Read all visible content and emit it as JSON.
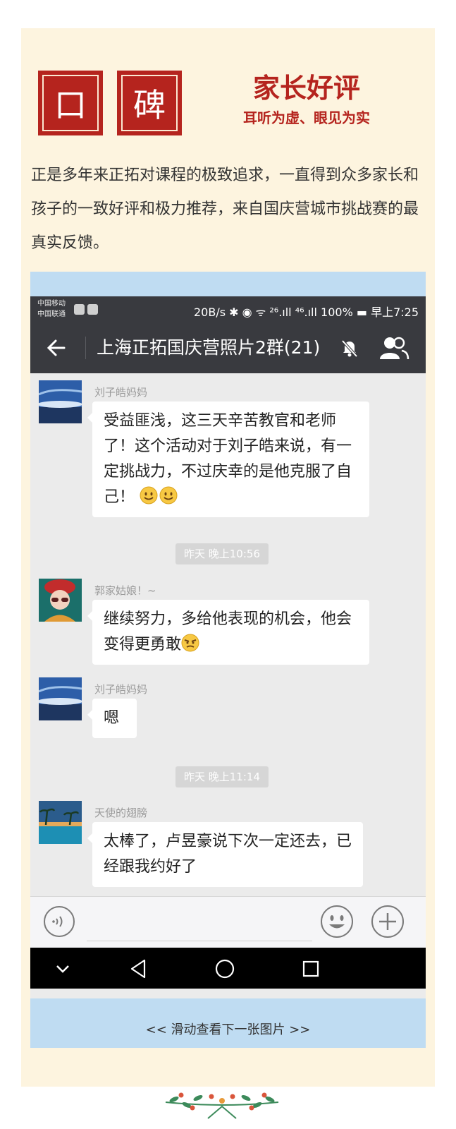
{
  "header": {
    "seal_1": "口",
    "seal_2": "碑",
    "title": "家长好评",
    "subtitle": "耳听为虚、眼见为实"
  },
  "intro_text": "正是多年来正拓对课程的极致追求，一直得到众多家长和孩子的一致好评和极力推荐，来自国庆营城市挑战赛的最真实反馈。",
  "status_bar": {
    "carrier_1": "中国移动",
    "carrier_2": "中国联通",
    "right": "20B/s ✱ ◉ ᯤ ²⁶.ıll ⁴⁶.ıll 100% ▬ 早上7:25"
  },
  "chat": {
    "title": "上海正拓国庆营照片2群(21)",
    "messages": [
      {
        "sender": "刘子皓妈妈",
        "text": "受益匪浅，这三天辛苦教官和老师了！这个活动对于刘子皓来说，有一定挑战力，不过庆幸的是他克服了自己！"
      },
      {
        "timestamp": "昨天 晚上10:56"
      },
      {
        "sender": "郭家姑娘！~",
        "text": "继续努力，多给他表现的机会，他会变得更勇敢"
      },
      {
        "sender": "刘子皓妈妈",
        "text": "嗯"
      },
      {
        "timestamp": "昨天 晚上11:14"
      },
      {
        "sender": "天使的翅膀",
        "text": "太棒了，卢昱豪说下次一定还去，已经跟我约好了"
      }
    ]
  },
  "input": {
    "value": ""
  },
  "swipe_hint": "<< 滑动查看下一张图片 >>",
  "colors": {
    "brand_red": "#b5241e",
    "card_bg": "#fdf4df",
    "frame_blue": "#bfdcf2",
    "wechat_dark": "#393a3f"
  }
}
